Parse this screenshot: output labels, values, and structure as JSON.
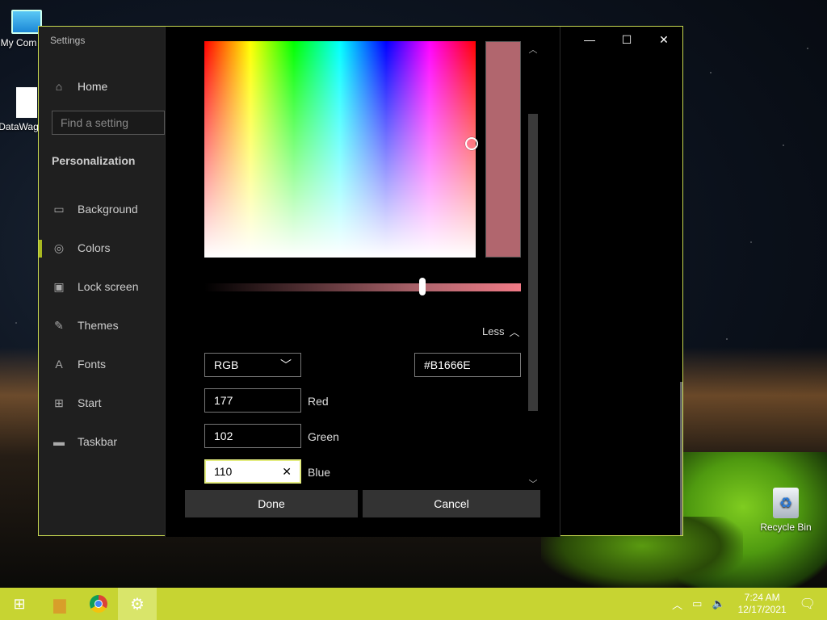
{
  "desktop": {
    "icons": [
      {
        "label": "My Com"
      },
      {
        "label": "DataWag"
      },
      {
        "label": "Recycle Bin"
      }
    ]
  },
  "window": {
    "title": "Settings",
    "controls": {
      "minimize": "—",
      "maximize": "☐",
      "close": "✕"
    }
  },
  "sidebar": {
    "home": "Home",
    "search_placeholder": "Find a setting",
    "section": "Personalization",
    "items": [
      {
        "label": "Background",
        "icon": "image-icon"
      },
      {
        "label": "Colors",
        "icon": "palette-icon",
        "active": true
      },
      {
        "label": "Lock screen",
        "icon": "lock-screen-icon"
      },
      {
        "label": "Themes",
        "icon": "brush-icon"
      },
      {
        "label": "Fonts",
        "icon": "fonts-icon"
      },
      {
        "label": "Start",
        "icon": "start-icon"
      },
      {
        "label": "Taskbar",
        "icon": "taskbar-icon"
      }
    ]
  },
  "color_dialog": {
    "preview_color": "#B1666E",
    "less_label": "Less",
    "model": "RGB",
    "hex": "#B1666E",
    "red": {
      "value": "177",
      "label": "Red"
    },
    "green": {
      "value": "102",
      "label": "Green"
    },
    "blue": {
      "value": "110",
      "label": "Blue"
    },
    "clear_glyph": "✕",
    "brightness_level": 0.69,
    "done_label": "Done",
    "cancel_label": "Cancel"
  },
  "taskbar": {
    "accent": "#C7D432",
    "clock": {
      "time": "7:24 AM",
      "date": "12/17/2021"
    }
  }
}
